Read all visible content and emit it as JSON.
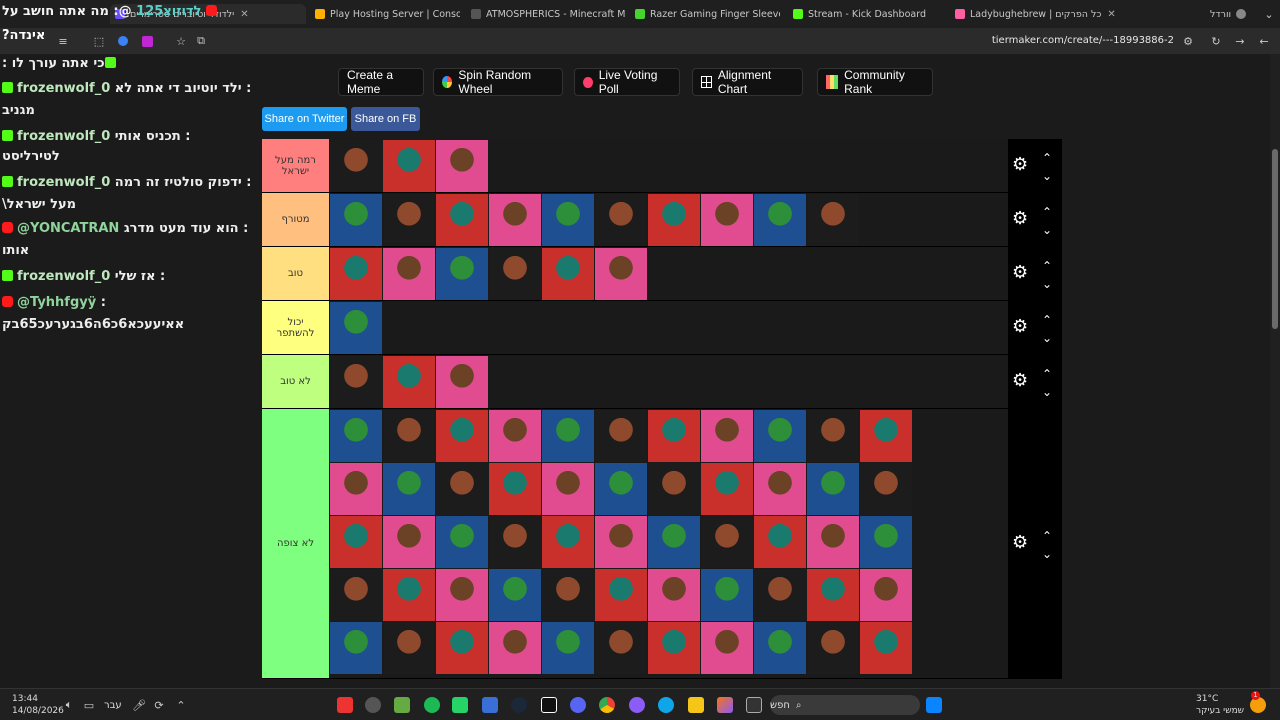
{
  "browser": {
    "tabs": [
      {
        "label": "ילדוזיו יוטיוברים סטרימרים",
        "active": true,
        "color": "#6d4cff"
      },
      {
        "label": "Play Hosting Server | Console",
        "color": "#ffb000"
      },
      {
        "label": "ATMOSPHERICS - Minecraft M...",
        "color": "#333333"
      },
      {
        "label": "Razer Gaming Finger Sleeve - ...",
        "color": "#44d62c"
      },
      {
        "label": "Stream - Kick Dashboard",
        "color": "#53fc18"
      },
      {
        "label": "Ladybughebrew | כל הפרקים",
        "color": "#ff5fa2"
      },
      {
        "label": "וורדל",
        "color": "#888888"
      }
    ],
    "url": "tiermaker.com/create/---18993886-2"
  },
  "overlay": {
    "top_name": "לדוזוצ125",
    "top_text": "@: מה אתה חושב על",
    "question": "?אינדה"
  },
  "chat": [
    {
      "platform": "kick",
      "user": "",
      "text": "כי אתה עורך לו :"
    },
    {
      "platform": "kick",
      "user": "frozenwolf_0",
      "text": "ילד יוטיוב די אתה לא :"
    },
    {
      "platform": "",
      "user": "",
      "text": "מגניב"
    },
    {
      "platform": "kick",
      "user": "frozenwolf_0",
      "text": "תכניס אותי :"
    },
    {
      "platform": "",
      "user": "",
      "text": "לטירליסט"
    },
    {
      "platform": "kick",
      "user": "frozenwolf_0",
      "text": "ידפוק סולטיז זה רמה :"
    },
    {
      "platform": "",
      "user": "",
      "text": "מעל ישראל\\"
    },
    {
      "platform": "yt",
      "user": "@YONCATRAN",
      "text": "הוא עוד מעט מדרג :"
    },
    {
      "platform": "",
      "user": "",
      "text": "אותו"
    },
    {
      "platform": "kick",
      "user": "frozenwolf_0",
      "text": "אז שלי :"
    },
    {
      "platform": "yt",
      "user": "@Tyhhfgyÿ",
      "text": ":"
    },
    {
      "platform": "",
      "user": "",
      "text": "אאיעעכא6כ6ה6בגערעכ65בק"
    }
  ],
  "buttons": [
    {
      "label": "Create a Meme",
      "icon": ""
    },
    {
      "label": "Spin Random Wheel",
      "icon": "wheel-icon"
    },
    {
      "label": "Live Voting Poll",
      "icon": "poll-icon"
    },
    {
      "label": "Alignment Chart",
      "icon": "grid-icon"
    },
    {
      "label": "Community Rank",
      "icon": "rank-icon"
    }
  ],
  "share": [
    {
      "label": "Share on Twitter",
      "color": "#1d9bf0"
    },
    {
      "label": "Share on FB",
      "color": "#3b5998"
    }
  ],
  "tiers": [
    {
      "label": "רמה מעל ישראל",
      "color": "#ff7f7f",
      "count": 3
    },
    {
      "label": "מטורף",
      "color": "#ffbf7f",
      "count": 10
    },
    {
      "label": "טוב",
      "color": "#ffdf7f",
      "count": 6
    },
    {
      "label": "יכול להשתפר",
      "color": "#ffff7f",
      "count": 1
    },
    {
      "label": "לא טוב",
      "color": "#bfff7f",
      "count": 3
    },
    {
      "label": "לא צופה",
      "color": "#7fff7f",
      "count": 55
    }
  ],
  "taskbar": {
    "time": "13:44",
    "date": "14/08/2026",
    "lang": "עבר",
    "search": "חפש",
    "weather_temp": "31°C",
    "weather_text": "שמשי בעיקר",
    "notif": "1"
  }
}
